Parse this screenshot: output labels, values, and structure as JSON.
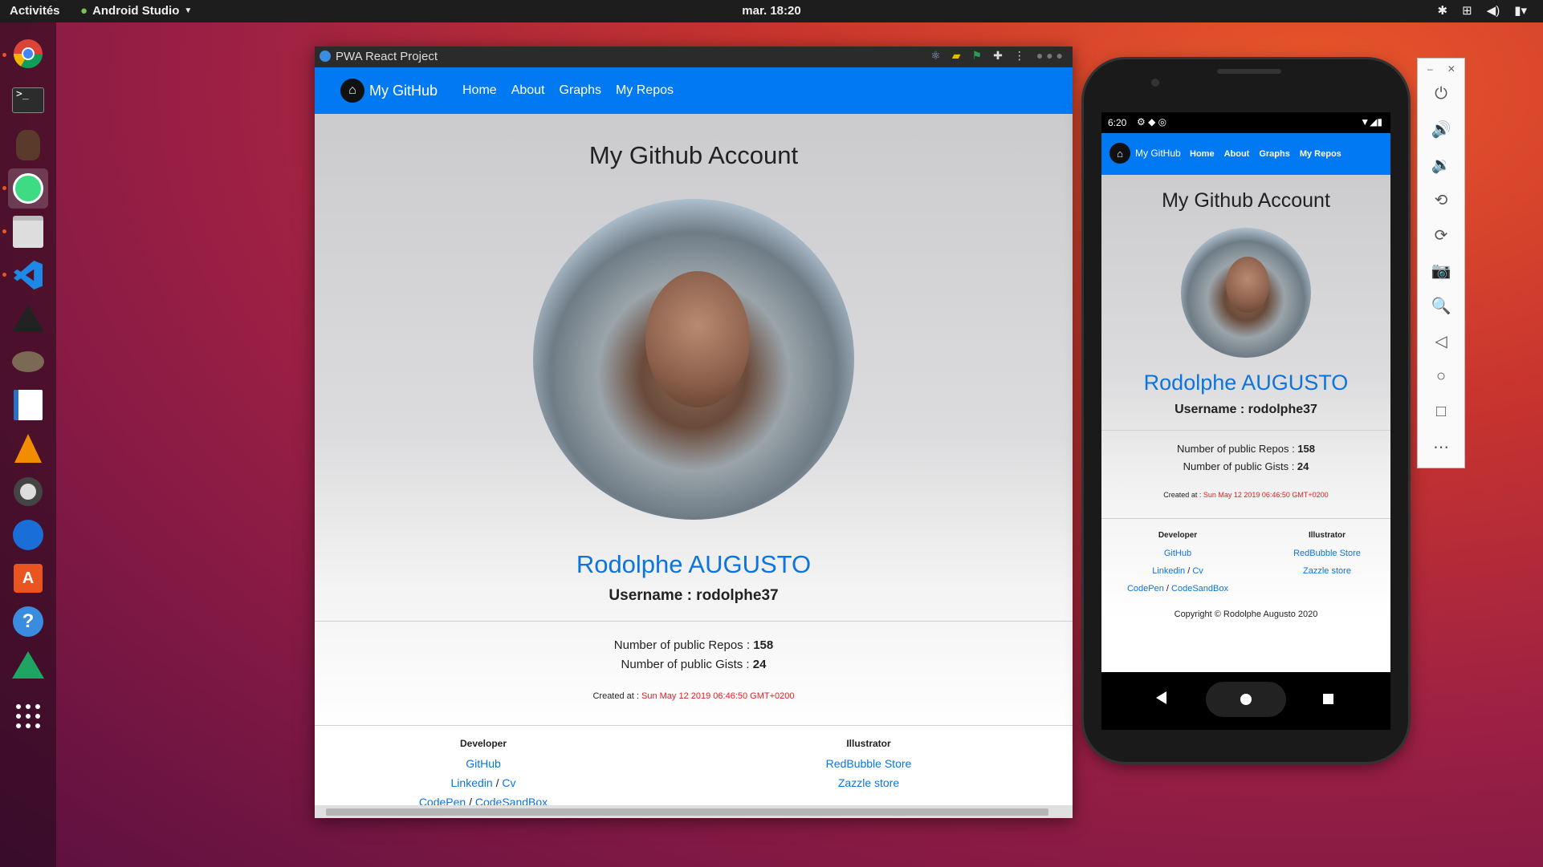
{
  "topbar": {
    "activities": "Activités",
    "app_name": "Android Studio",
    "clock": "mar. 18:20"
  },
  "dock": {
    "items": [
      "chrome-icon",
      "terminal-icon",
      "beaver-icon",
      "android-studio-icon",
      "files-icon",
      "vscode-icon",
      "inkscape-icon",
      "gimp-icon",
      "writer-icon",
      "vlc-icon",
      "rhythmbox-icon",
      "thunderbird-icon",
      "software-icon",
      "help-icon",
      "google-drive-icon",
      "show-apps-icon"
    ]
  },
  "browser": {
    "window_title": "PWA React Project",
    "brand": "My GitHub",
    "nav": [
      "Home",
      "About",
      "Graphs",
      "My Repos"
    ],
    "heading": "My Github Account",
    "name": "Rodolphe AUGUSTO",
    "username": "Username : rodolphe37",
    "repos_label": "Number of public Repos : ",
    "repos_value": "158",
    "gists_label": "Number of public Gists : ",
    "gists_value": "24",
    "created_label": "Created at : ",
    "created_value": "Sun May 12 2019 06:46:50 GMT+0200",
    "developer_heading": "Developer",
    "illustrator_heading": "Illustrator",
    "links": {
      "github": "GitHub",
      "linkedin": "Linkedin",
      "sep": "/",
      "cv": "Cv",
      "codepen": "CodePen",
      "codesandbox": "CodeSandBox",
      "redbubble": "RedBubble Store",
      "zazzle": "Zazzle store"
    },
    "copyright": "Copyright © Rodolphe Augusto 2020"
  },
  "phone": {
    "time": "6:20"
  },
  "colors": {
    "accent": "#0079f3",
    "link": "#0b74de",
    "date_red": "#e02020"
  }
}
